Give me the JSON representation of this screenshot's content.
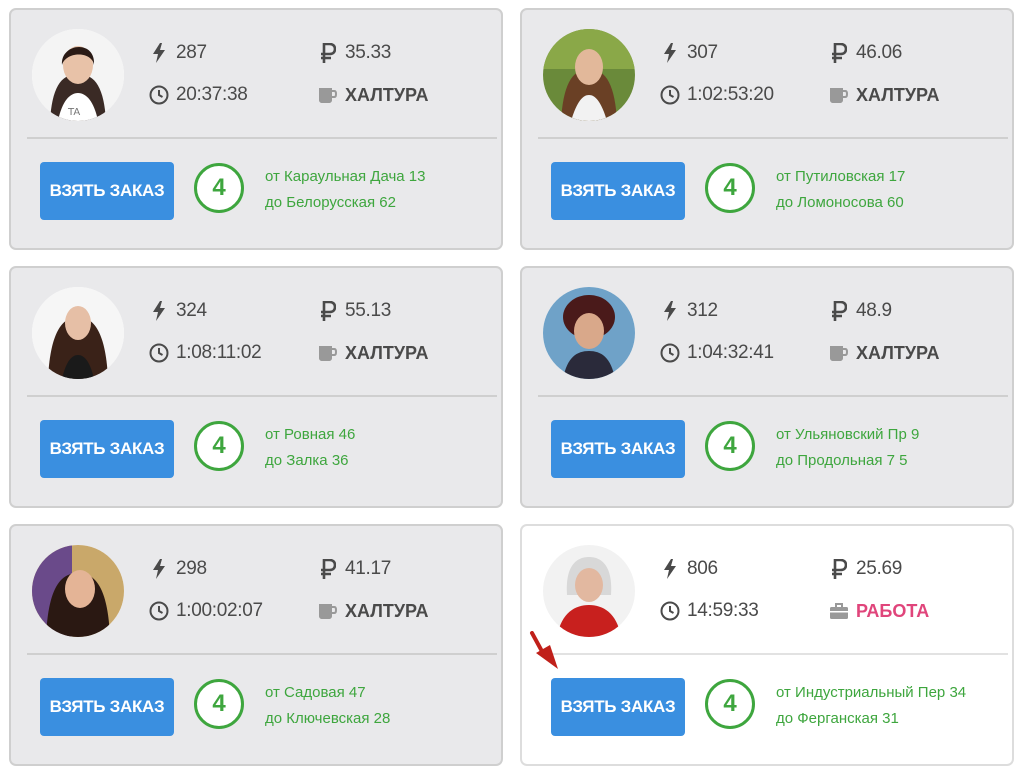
{
  "colors": {
    "accent": "#3a8fe0",
    "green": "#3ea63e",
    "work": "#e0457b",
    "card_bg": "#e9e9eb",
    "arrow": "#c0201a"
  },
  "icons": {
    "energy": "bolt-icon",
    "price": "ruble-icon",
    "time": "clock-icon",
    "job": "coffee-cup-icon",
    "job_work": "briefcase-icon"
  },
  "cards": [
    {
      "energy": "287",
      "price": "35.33",
      "time": "20:37:38",
      "status": "ХАЛТУРА",
      "button_label": "ВЗЯТЬ ЗАКАЗ",
      "level": "4",
      "route_from": "от Караульная Дача 13",
      "route_to": "до Белорусская 62"
    },
    {
      "energy": "307",
      "price": "46.06",
      "time": "1:02:53:20",
      "status": "ХАЛТУРА",
      "button_label": "ВЗЯТЬ ЗАКАЗ",
      "level": "4",
      "route_from": "от Путиловская 17",
      "route_to": "до Ломоносова 60"
    },
    {
      "energy": "324",
      "price": "55.13",
      "time": "1:08:11:02",
      "status": "ХАЛТУРА",
      "button_label": "ВЗЯТЬ ЗАКАЗ",
      "level": "4",
      "route_from": "от Ровная 46",
      "route_to": "до Залка 36"
    },
    {
      "energy": "312",
      "price": "48.9",
      "time": "1:04:32:41",
      "status": "ХАЛТУРА",
      "button_label": "ВЗЯТЬ ЗАКАЗ",
      "level": "4",
      "route_from": "от Ульяновский Пр 9",
      "route_to": "до Продольная 7 5"
    },
    {
      "energy": "298",
      "price": "41.17",
      "time": "1:00:02:07",
      "status": "ХАЛТУРА",
      "button_label": "ВЗЯТЬ ЗАКАЗ",
      "level": "4",
      "route_from": "от Садовая 47",
      "route_to": "до Ключевская 28"
    },
    {
      "energy": "806",
      "price": "25.69",
      "time": "14:59:33",
      "status": "РАБОТА",
      "button_label": "ВЗЯТЬ ЗАКАЗ",
      "level": "4",
      "route_from": "от Индустриальный Пер 34",
      "route_to": "до Ферганская 31"
    }
  ]
}
